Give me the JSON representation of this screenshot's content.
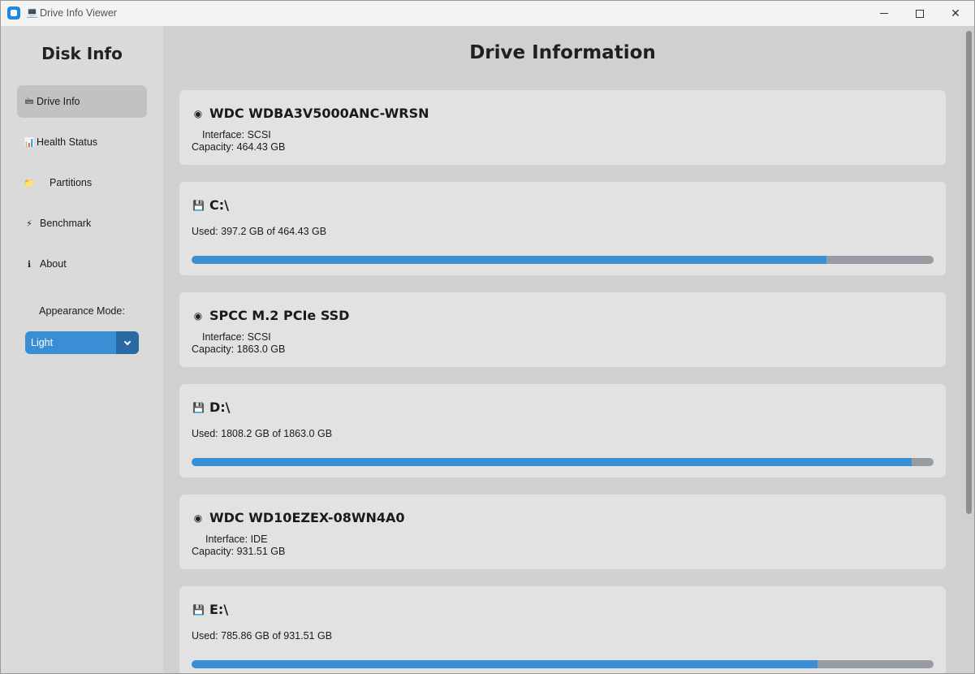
{
  "window": {
    "title": "Drive Info Viewer",
    "title_icon": "computer-icon",
    "controls": {
      "minimize": "minimize-icon",
      "maximize": "maximize-icon",
      "close": "close-icon"
    }
  },
  "sidebar": {
    "title": "Disk Info",
    "items": [
      {
        "label": "Drive Info",
        "icon": "drive-icon",
        "active": true
      },
      {
        "label": "Health Status",
        "icon": "chart-icon",
        "active": false
      },
      {
        "label": "Partitions",
        "icon": "folder-icon",
        "active": false
      },
      {
        "label": "Benchmark",
        "icon": "lightning-icon",
        "active": false
      },
      {
        "label": "About",
        "icon": "info-icon",
        "active": false
      }
    ],
    "appearance_label": "Appearance Mode:",
    "appearance_value": "Light"
  },
  "main": {
    "title": "Drive Information",
    "cards": [
      {
        "type": "disk",
        "name": "WDC WDBA3V5000ANC-WRSN",
        "icon": "disk-icon",
        "interface": "Interface: SCSI",
        "capacity": "Capacity: 464.43 GB"
      },
      {
        "type": "partition",
        "name": "C:\\",
        "icon": "floppy-icon",
        "used": "Used: 397.2 GB of 464.43 GB",
        "fraction": 0.8553
      },
      {
        "type": "disk",
        "name": "SPCC M.2 PCIe SSD",
        "icon": "disk-icon",
        "interface": "Interface: SCSI",
        "capacity": "Capacity: 1863.0 GB"
      },
      {
        "type": "partition",
        "name": "D:\\",
        "icon": "floppy-icon",
        "used": "Used: 1808.2 GB of 1863.0 GB",
        "fraction": 0.9706
      },
      {
        "type": "disk",
        "name": "WDC WD10EZEX-08WN4A0",
        "icon": "disk-icon",
        "interface": "Interface: IDE",
        "capacity": "Capacity: 931.51 GB"
      },
      {
        "type": "partition",
        "name": "E:\\",
        "icon": "floppy-icon",
        "used": "Used: 785.86 GB of 931.51 GB",
        "fraction": 0.8436
      }
    ]
  },
  "colors": {
    "accent": "#3a8ed4",
    "accent_dark": "#2a6aa4",
    "bar_track": "#969ba1",
    "card_bg": "#e2e2e2",
    "sidebar_bg": "#dadada",
    "main_bg": "#d0d0d0"
  }
}
